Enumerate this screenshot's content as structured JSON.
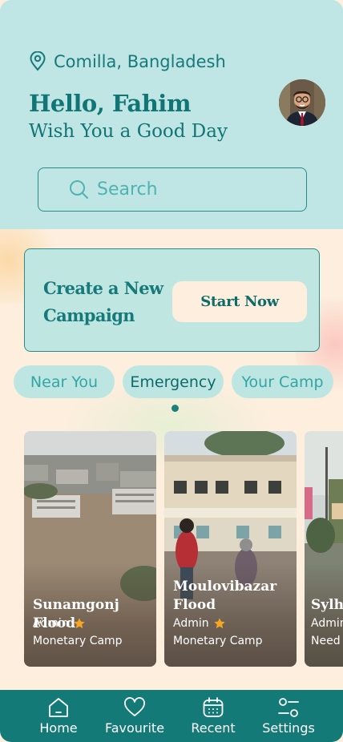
{
  "header": {
    "location": "Comilla, Bangladesh",
    "greeting": "Hello, Fahim",
    "subtitle": "Wish You a Good Day",
    "avatar_alt": "user-avatar"
  },
  "search": {
    "placeholder": "Search"
  },
  "banner": {
    "text": "Create a New Campaign",
    "button": "Start Now"
  },
  "tabs": [
    {
      "label": "Near You"
    },
    {
      "label": "Emergency"
    },
    {
      "label": "Your Camp"
    }
  ],
  "cards": [
    {
      "title": "Sunamgonj Flood",
      "admin": "Admin",
      "type": "Monetary Camp"
    },
    {
      "title": "Moulovibazar\n Flood",
      "admin": "Admin",
      "type": "Monetary Camp"
    },
    {
      "title": "Sylhet Flood",
      "admin": "Admin",
      "type": "Need Volunteer"
    }
  ],
  "nav": [
    {
      "label": "Home",
      "icon": "home-icon"
    },
    {
      "label": "Favourite",
      "icon": "heart-icon"
    },
    {
      "label": "Recent",
      "icon": "calendar-icon"
    },
    {
      "label": "Settings",
      "icon": "settings-icon"
    }
  ],
  "colors": {
    "header_bg": "#bfe6e4",
    "accent": "#137a78",
    "page_bg": "#fdeedd"
  }
}
